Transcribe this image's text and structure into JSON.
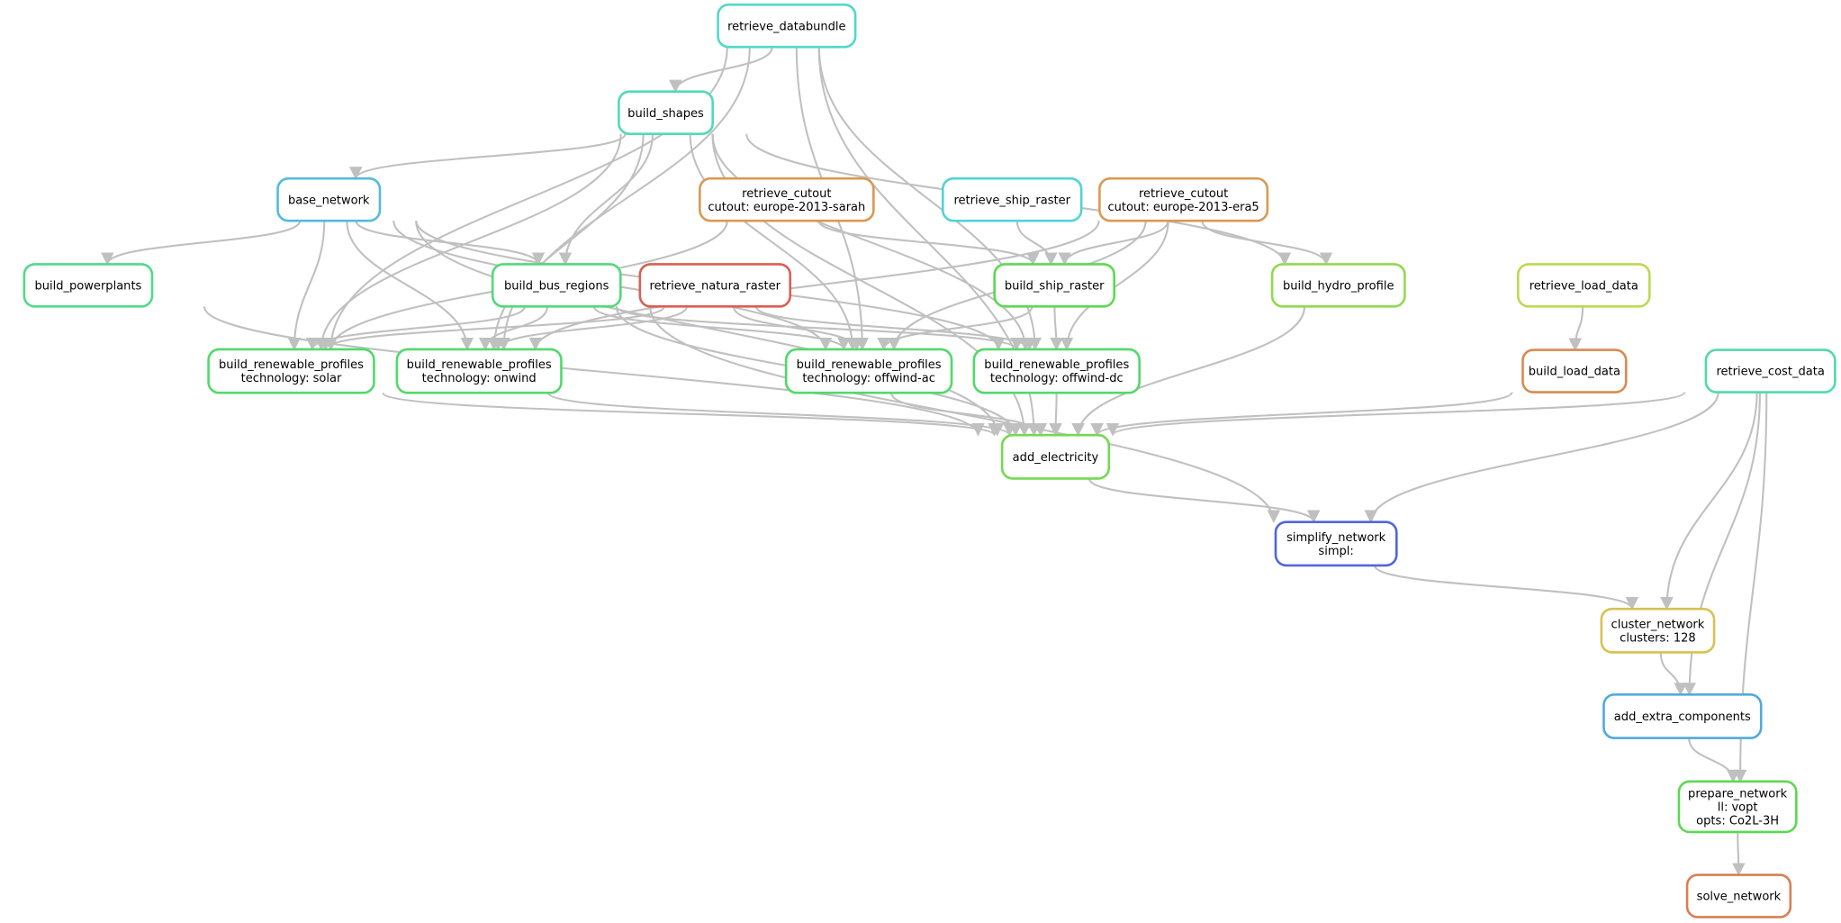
{
  "nodes": [
    {
      "id": "retrieve_databundle",
      "lines": [
        "retrieve_databundle"
      ],
      "color": "#52d9c6"
    },
    {
      "id": "build_shapes",
      "lines": [
        "build_shapes"
      ],
      "color": "#52d9b8"
    },
    {
      "id": "base_network",
      "lines": [
        "base_network"
      ],
      "color": "#52bcd9"
    },
    {
      "id": "retrieve_cutout_sarah",
      "lines": [
        "retrieve_cutout",
        "cutout: europe-2013-sarah"
      ],
      "color": "#d99a52"
    },
    {
      "id": "retrieve_ship_raster",
      "lines": [
        "retrieve_ship_raster"
      ],
      "color": "#52d2d9"
    },
    {
      "id": "retrieve_cutout_era5",
      "lines": [
        "retrieve_cutout",
        "cutout: europe-2013-era5"
      ],
      "color": "#d99a52"
    },
    {
      "id": "build_powerplants",
      "lines": [
        "build_powerplants"
      ],
      "color": "#52d98a"
    },
    {
      "id": "build_bus_regions",
      "lines": [
        "build_bus_regions"
      ],
      "color": "#52d97a"
    },
    {
      "id": "retrieve_natura_raster",
      "lines": [
        "retrieve_natura_raster"
      ],
      "color": "#d95f52"
    },
    {
      "id": "build_ship_raster",
      "lines": [
        "build_ship_raster"
      ],
      "color": "#5cd952"
    },
    {
      "id": "build_hydro_profile",
      "lines": [
        "build_hydro_profile"
      ],
      "color": "#92d952"
    },
    {
      "id": "retrieve_load_data",
      "lines": [
        "retrieve_load_data"
      ],
      "color": "#bcd952"
    },
    {
      "id": "brp_solar",
      "lines": [
        "build_renewable_profiles",
        "technology: solar"
      ],
      "color": "#52d96a"
    },
    {
      "id": "brp_onwind",
      "lines": [
        "build_renewable_profiles",
        "technology: onwind"
      ],
      "color": "#52d96a"
    },
    {
      "id": "brp_offwind_ac",
      "lines": [
        "build_renewable_profiles",
        "technology: offwind-ac"
      ],
      "color": "#52d96a"
    },
    {
      "id": "brp_offwind_dc",
      "lines": [
        "build_renewable_profiles",
        "technology: offwind-dc"
      ],
      "color": "#52d96a"
    },
    {
      "id": "build_load_data",
      "lines": [
        "build_load_data"
      ],
      "color": "#d98a52"
    },
    {
      "id": "retrieve_cost_data",
      "lines": [
        "retrieve_cost_data"
      ],
      "color": "#52d9aa"
    },
    {
      "id": "add_electricity",
      "lines": [
        "add_electricity"
      ],
      "color": "#74d952"
    },
    {
      "id": "simplify_network",
      "lines": [
        "simplify_network",
        "simpl:"
      ],
      "color": "#5266d9"
    },
    {
      "id": "cluster_network",
      "lines": [
        "cluster_network",
        "clusters: 128"
      ],
      "color": "#d9c152"
    },
    {
      "id": "add_extra_components",
      "lines": [
        "add_extra_components"
      ],
      "color": "#52aad9"
    },
    {
      "id": "prepare_network",
      "lines": [
        "prepare_network",
        "ll: vopt",
        "opts: Co2L-3H"
      ],
      "color": "#5cd952"
    },
    {
      "id": "solve_network",
      "lines": [
        "solve_network"
      ],
      "color": "#d97f52"
    }
  ],
  "edges": [
    [
      "retrieve_databundle",
      "build_shapes"
    ],
    [
      "retrieve_databundle",
      "brp_solar"
    ],
    [
      "retrieve_databundle",
      "brp_onwind"
    ],
    [
      "retrieve_databundle",
      "brp_offwind_ac"
    ],
    [
      "retrieve_databundle",
      "brp_offwind_dc"
    ],
    [
      "retrieve_databundle",
      "add_electricity"
    ],
    [
      "build_shapes",
      "base_network"
    ],
    [
      "build_shapes",
      "build_bus_regions"
    ],
    [
      "build_shapes",
      "brp_solar"
    ],
    [
      "build_shapes",
      "brp_onwind"
    ],
    [
      "build_shapes",
      "brp_offwind_ac"
    ],
    [
      "build_shapes",
      "brp_offwind_dc"
    ],
    [
      "build_shapes",
      "build_hydro_profile"
    ],
    [
      "build_shapes",
      "add_electricity"
    ],
    [
      "base_network",
      "build_powerplants"
    ],
    [
      "base_network",
      "build_bus_regions"
    ],
    [
      "base_network",
      "brp_solar"
    ],
    [
      "base_network",
      "brp_onwind"
    ],
    [
      "base_network",
      "brp_offwind_ac"
    ],
    [
      "base_network",
      "brp_offwind_dc"
    ],
    [
      "base_network",
      "add_electricity"
    ],
    [
      "retrieve_cutout_sarah",
      "brp_solar"
    ],
    [
      "retrieve_cutout_sarah",
      "build_ship_raster"
    ],
    [
      "retrieve_ship_raster",
      "build_ship_raster"
    ],
    [
      "retrieve_cutout_era5",
      "build_ship_raster"
    ],
    [
      "retrieve_cutout_era5",
      "brp_onwind"
    ],
    [
      "retrieve_cutout_era5",
      "brp_offwind_ac"
    ],
    [
      "retrieve_cutout_era5",
      "brp_offwind_dc"
    ],
    [
      "retrieve_cutout_era5",
      "build_hydro_profile"
    ],
    [
      "build_powerplants",
      "add_electricity"
    ],
    [
      "build_bus_regions",
      "brp_solar"
    ],
    [
      "build_bus_regions",
      "brp_onwind"
    ],
    [
      "build_bus_regions",
      "brp_offwind_ac"
    ],
    [
      "build_bus_regions",
      "brp_offwind_dc"
    ],
    [
      "build_bus_regions",
      "add_electricity"
    ],
    [
      "build_bus_regions",
      "simplify_network"
    ],
    [
      "retrieve_natura_raster",
      "brp_solar"
    ],
    [
      "retrieve_natura_raster",
      "brp_onwind"
    ],
    [
      "retrieve_natura_raster",
      "brp_offwind_ac"
    ],
    [
      "retrieve_natura_raster",
      "brp_offwind_dc"
    ],
    [
      "build_ship_raster",
      "brp_offwind_ac"
    ],
    [
      "build_ship_raster",
      "brp_offwind_dc"
    ],
    [
      "build_hydro_profile",
      "add_electricity"
    ],
    [
      "retrieve_load_data",
      "build_load_data"
    ],
    [
      "build_load_data",
      "add_electricity"
    ],
    [
      "brp_solar",
      "add_electricity"
    ],
    [
      "brp_onwind",
      "add_electricity"
    ],
    [
      "brp_offwind_ac",
      "add_electricity"
    ],
    [
      "brp_offwind_dc",
      "add_electricity"
    ],
    [
      "retrieve_cost_data",
      "add_electricity"
    ],
    [
      "retrieve_cost_data",
      "simplify_network"
    ],
    [
      "retrieve_cost_data",
      "cluster_network"
    ],
    [
      "retrieve_cost_data",
      "add_extra_components"
    ],
    [
      "retrieve_cost_data",
      "prepare_network"
    ],
    [
      "add_electricity",
      "simplify_network"
    ],
    [
      "simplify_network",
      "cluster_network"
    ],
    [
      "cluster_network",
      "add_extra_components"
    ],
    [
      "add_extra_components",
      "prepare_network"
    ],
    [
      "prepare_network",
      "solve_network"
    ]
  ],
  "edge_color": "#c0c0c0"
}
